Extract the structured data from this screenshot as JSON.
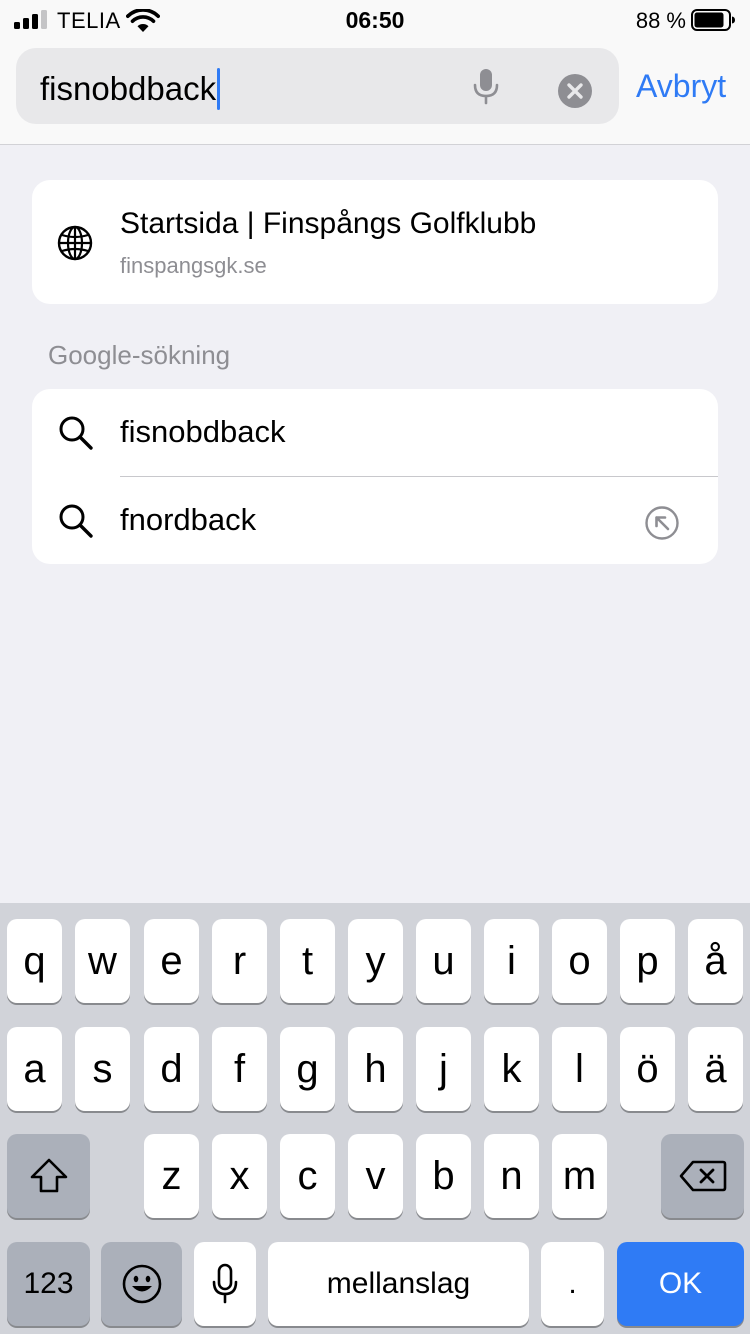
{
  "status_bar": {
    "carrier": "TELIA",
    "time": "06:50",
    "battery_percent": "88 %",
    "battery_level": 0.88,
    "signal_bars": 3
  },
  "search": {
    "query": "fisnobdback",
    "cancel_label": "Avbryt"
  },
  "top_hit": {
    "title": "Startsida | Finspångs Golfklubb",
    "url": "finspangsgk.se",
    "icon": "globe-icon"
  },
  "google": {
    "section_label": "Google-sökning",
    "suggestions": [
      {
        "text": "fisnobdback",
        "icon": "search-icon"
      },
      {
        "text": "fnordback",
        "icon": "search-icon",
        "action_icon": "fill-arrow-icon"
      }
    ]
  },
  "keyboard": {
    "row1": [
      "q",
      "w",
      "e",
      "r",
      "t",
      "y",
      "u",
      "i",
      "o",
      "p",
      "å"
    ],
    "row2": [
      "a",
      "s",
      "d",
      "f",
      "g",
      "h",
      "j",
      "k",
      "l",
      "ö",
      "ä"
    ],
    "row3": [
      "z",
      "x",
      "c",
      "v",
      "b",
      "n",
      "m"
    ],
    "numbers_label": "123",
    "space_label": "mellanslag",
    "period_label": ".",
    "return_label": "OK"
  },
  "colors": {
    "accent": "#2f7bf5",
    "background": "#f0f0f5",
    "secondary_text": "#8e8e93",
    "keyboard_bg": "#d1d3d9"
  }
}
